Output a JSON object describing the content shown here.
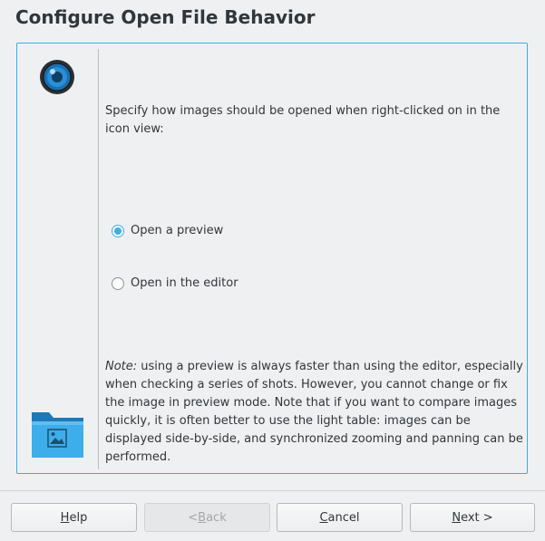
{
  "window": {
    "title": "Configure Open File Behavior"
  },
  "panel": {
    "description": "Specify how images should be opened when right-clicked on in the icon view:",
    "options": [
      {
        "label": "Open a preview",
        "checked": true
      },
      {
        "label": "Open in the editor",
        "checked": false
      }
    ],
    "note_label": "Note:",
    "note_text": " using a preview is always faster than using the editor, especially when checking a series of shots. However, you cannot change or fix the image in preview mode. Note that if you want to compare images quickly, it is often better to use the light table: images can be displayed side-by-side, and synchronized zooming and panning can be performed."
  },
  "buttons": {
    "help": {
      "mnemonic": "H",
      "rest": "elp"
    },
    "back": {
      "prefix": "< ",
      "mnemonic": "B",
      "rest": "ack",
      "enabled": false
    },
    "cancel": {
      "mnemonic": "C",
      "rest": "ancel"
    },
    "next": {
      "mnemonic": "N",
      "rest": "ext >"
    }
  },
  "icons": {
    "app": "camera-lens-icon",
    "folder": "pictures-folder-icon"
  },
  "colors": {
    "accent": "#3daee9",
    "background": "#eff0f1",
    "text": "#31363b"
  }
}
